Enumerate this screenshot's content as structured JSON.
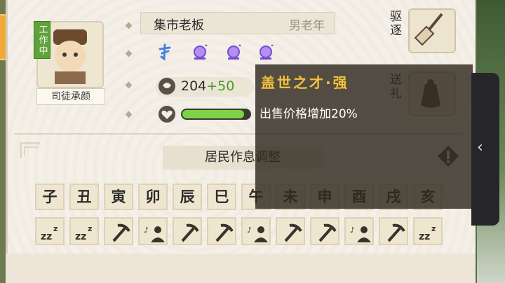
{
  "character": {
    "name": "司徒承颜",
    "status": "工作中",
    "role": "集市老板",
    "attribute": "男老年",
    "coins": "204",
    "coins_bonus": "+50",
    "health_fraction": 0.92
  },
  "traits": [
    {
      "icon": "talent-icon",
      "color": "#4a7fe0"
    },
    {
      "icon": "potion-icon",
      "color": "#8a5ad6"
    },
    {
      "icon": "potion-icon",
      "color": "#8a5ad6"
    },
    {
      "icon": "potion-icon",
      "color": "#8a5ad6"
    }
  ],
  "actions": {
    "expel_label": "驱逐",
    "gift_label": "送礼"
  },
  "schedule": {
    "title": "居民作息调整",
    "hours": [
      "子",
      "丑",
      "寅",
      "卯",
      "辰",
      "巳",
      "午",
      "未",
      "申",
      "酉",
      "戌",
      "亥"
    ],
    "activities": [
      "sleep",
      "sleep",
      "work",
      "leisure",
      "work",
      "work",
      "leisure",
      "work",
      "work",
      "leisure",
      "work",
      "sleep"
    ]
  },
  "tooltip": {
    "title": "盖世之才·强",
    "description": "出售价格增加20%"
  },
  "side_tab": {
    "icon": "chevron-left-icon",
    "glyph": "‹"
  }
}
